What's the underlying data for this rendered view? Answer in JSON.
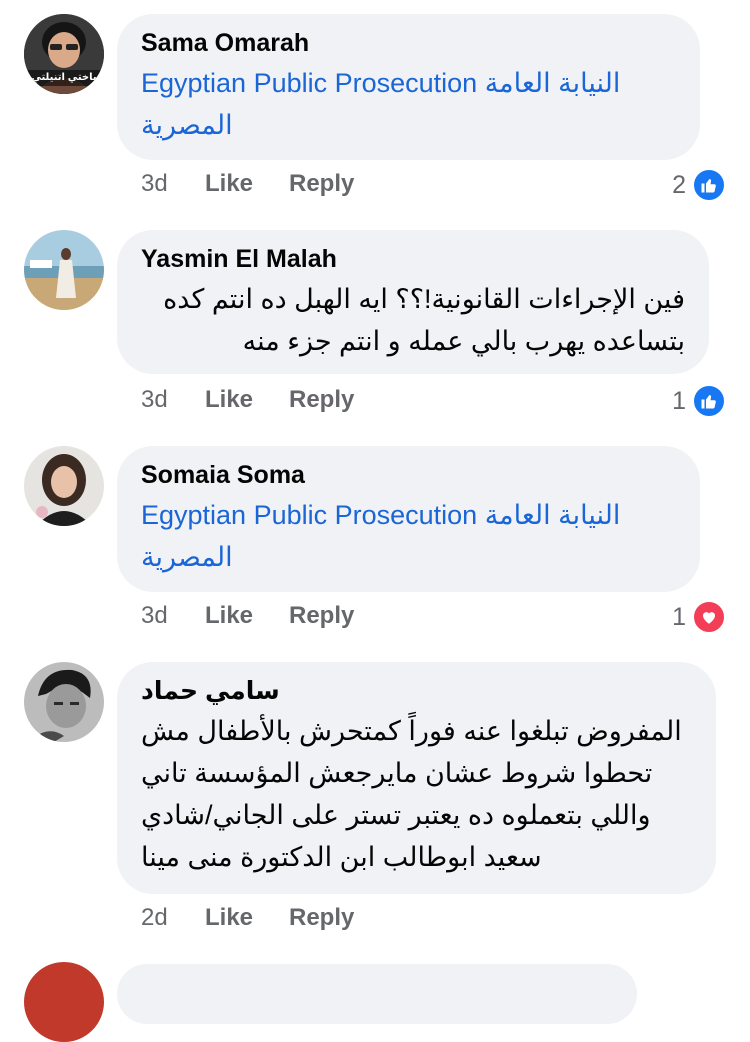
{
  "comments": [
    {
      "author": "Sama Omarah",
      "avatar_caption": "باختي اتنيلتي",
      "text_lines": [
        "Egyptian Public Prosecution النيابة العامة",
        "المصرية"
      ],
      "time": "3d",
      "like_label": "Like",
      "reply_label": "Reply",
      "reaction_count": "2",
      "reaction_icon": "like-icon",
      "reaction_color": "#1877f2"
    },
    {
      "author": "Yasmin El Malah",
      "text_lines": [
        "فين الإجراءات القانونية!؟؟ ايه الهبل ده انتم كده",
        "بتساعده يهرب بالي عمله و انتم جزء منه"
      ],
      "time": "3d",
      "like_label": "Like",
      "reply_label": "Reply",
      "reaction_count": "1",
      "reaction_icon": "like-icon",
      "reaction_color": "#1877f2"
    },
    {
      "author": "Somaia Soma",
      "text_lines": [
        "Egyptian Public Prosecution النيابة العامة",
        "المصرية"
      ],
      "time": "3d",
      "like_label": "Like",
      "reply_label": "Reply",
      "reaction_count": "1",
      "reaction_icon": "heart-icon",
      "reaction_color": "#f33e58"
    },
    {
      "author": "سامي حماد",
      "text_lines": [
        "المفروض تبلغوا عنه فوراً كمتحرش بالأطفال مش",
        "تحطوا شروط عشان مايرجعش المؤسسة تاني",
        "واللي بتعملوه ده يعتبر تستر على الجاني/شادي",
        "سعيد ابوطالب ابن الدكتورة منى مينا"
      ],
      "time": "2d",
      "like_label": "Like",
      "reply_label": "Reply"
    }
  ],
  "colors": {
    "link": "#1a66d6",
    "bubble": "#f0f2f5",
    "meta": "#65676b"
  }
}
